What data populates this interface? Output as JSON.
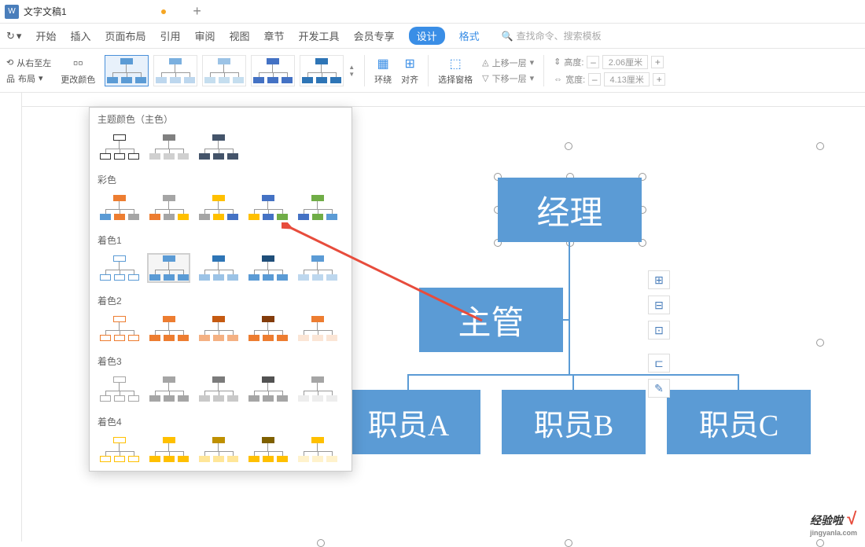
{
  "title_bar": {
    "doc_icon": "W",
    "doc_title": "文字文稿1",
    "add": "+"
  },
  "menu": {
    "redo": "↻",
    "items": [
      "开始",
      "插入",
      "页面布局",
      "引用",
      "审阅",
      "视图",
      "章节",
      "开发工具",
      "会员专享"
    ],
    "design": "设计",
    "format": "格式",
    "search_placeholder": "查找命令、搜索模板"
  },
  "toolbar": {
    "rtl": "从右至左",
    "layout": "布局",
    "change_color": "更改颜色",
    "wrap": "环绕",
    "align": "对齐",
    "select_pane": "选择窗格",
    "move_up": "上移一层",
    "move_down": "下移一层",
    "height": "高度:",
    "width": "宽度:",
    "height_val": "2.06厘米",
    "width_val": "4.13厘米",
    "minus": "–",
    "plus": "+"
  },
  "dropdown": {
    "s1": "主题颜色（主色）",
    "s2": "彩色",
    "s3": "着色1",
    "s4": "着色2",
    "s5": "着色3",
    "s6": "着色4"
  },
  "org": {
    "manager": "经理",
    "supervisor": "主管",
    "empA": "职员A",
    "empB": "职员B",
    "empC": "职员C"
  },
  "watermark": {
    "text": "经验啦",
    "check": "√",
    "sub": "jingyanla.com"
  },
  "chart_data": {
    "type": "org-chart",
    "nodes": [
      {
        "id": "manager",
        "label": "经理",
        "level": 0
      },
      {
        "id": "supervisor",
        "label": "主管",
        "level": 1,
        "parent": "manager"
      },
      {
        "id": "empA",
        "label": "职员A",
        "level": 2,
        "parent": "supervisor"
      },
      {
        "id": "empB",
        "label": "职员B",
        "level": 2,
        "parent": "supervisor"
      },
      {
        "id": "empC",
        "label": "职员C",
        "level": 2,
        "parent": "supervisor"
      }
    ],
    "color": "#5b9bd5"
  }
}
